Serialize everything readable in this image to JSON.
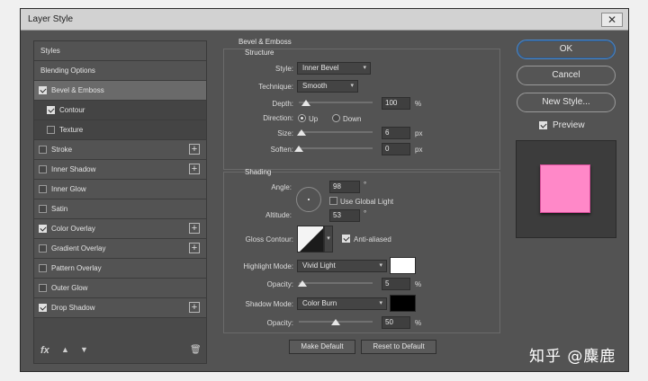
{
  "window": {
    "title": "Layer Style",
    "close_glyph": "✕"
  },
  "styles_list": [
    {
      "label": "Styles",
      "checkbox": false,
      "checked": false,
      "plus": false,
      "selected": false,
      "sub": false
    },
    {
      "label": "Blending Options",
      "checkbox": false,
      "checked": false,
      "plus": false,
      "selected": false,
      "sub": false
    },
    {
      "label": "Bevel & Emboss",
      "checkbox": true,
      "checked": true,
      "plus": false,
      "selected": true,
      "sub": false
    },
    {
      "label": "Contour",
      "checkbox": true,
      "checked": true,
      "plus": false,
      "selected": false,
      "sub": true
    },
    {
      "label": "Texture",
      "checkbox": true,
      "checked": false,
      "plus": false,
      "selected": false,
      "sub": true
    },
    {
      "label": "Stroke",
      "checkbox": true,
      "checked": false,
      "plus": true,
      "selected": false,
      "sub": false
    },
    {
      "label": "Inner Shadow",
      "checkbox": true,
      "checked": false,
      "plus": true,
      "selected": false,
      "sub": false
    },
    {
      "label": "Inner Glow",
      "checkbox": true,
      "checked": false,
      "plus": false,
      "selected": false,
      "sub": false
    },
    {
      "label": "Satin",
      "checkbox": true,
      "checked": false,
      "plus": false,
      "selected": false,
      "sub": false
    },
    {
      "label": "Color Overlay",
      "checkbox": true,
      "checked": true,
      "plus": true,
      "selected": false,
      "sub": false
    },
    {
      "label": "Gradient Overlay",
      "checkbox": true,
      "checked": false,
      "plus": true,
      "selected": false,
      "sub": false
    },
    {
      "label": "Pattern Overlay",
      "checkbox": true,
      "checked": false,
      "plus": false,
      "selected": false,
      "sub": false
    },
    {
      "label": "Outer Glow",
      "checkbox": true,
      "checked": false,
      "plus": false,
      "selected": false,
      "sub": false
    },
    {
      "label": "Drop Shadow",
      "checkbox": true,
      "checked": true,
      "plus": true,
      "selected": false,
      "sub": false
    }
  ],
  "left_footer": {
    "fx": "fx",
    "up": "▲",
    "down": "▼",
    "trash": "🗑"
  },
  "bevel": {
    "title": "Bevel & Emboss",
    "structure": {
      "title": "Structure",
      "style_label": "Style:",
      "style_value": "Inner Bevel",
      "technique_label": "Technique:",
      "technique_value": "Smooth",
      "depth_label": "Depth:",
      "depth_value": "100",
      "depth_unit": "%",
      "depth_level": 0.1,
      "direction_label": "Direction:",
      "direction_up": "Up",
      "direction_down": "Down",
      "size_label": "Size:",
      "size_value": "6",
      "size_unit": "px",
      "size_level": 0.04,
      "soften_label": "Soften:",
      "soften_value": "0",
      "soften_unit": "px",
      "soften_level": 0.0
    },
    "shading": {
      "title": "Shading",
      "angle_label": "Angle:",
      "angle_value": "98",
      "angle_unit": "°",
      "global_light_label": "Use Global Light",
      "global_light_checked": false,
      "altitude_label": "Altitude:",
      "altitude_value": "53",
      "altitude_unit": "°",
      "gloss_label": "Gloss Contour:",
      "antialiased_label": "Anti-aliased",
      "antialiased_checked": true,
      "highlight_label": "Highlight Mode:",
      "highlight_value": "Vivid Light",
      "highlight_color": "#ffffff",
      "hopacity_label": "Opacity:",
      "hopacity_value": "5",
      "hopacity_unit": "%",
      "hopacity_level": 0.05,
      "shadow_label": "Shadow Mode:",
      "shadow_value": "Color Burn",
      "shadow_color": "#000000",
      "sopacity_label": "Opacity:",
      "sopacity_value": "50",
      "sopacity_unit": "%",
      "sopacity_level": 0.5
    },
    "make_default": "Make Default",
    "reset_default": "Reset to Default"
  },
  "right": {
    "ok": "OK",
    "cancel": "Cancel",
    "new_style": "New Style...",
    "preview_label": "Preview",
    "preview_checked": true,
    "preview_color": "#ff88c8"
  },
  "watermark": "知乎 @麋鹿"
}
